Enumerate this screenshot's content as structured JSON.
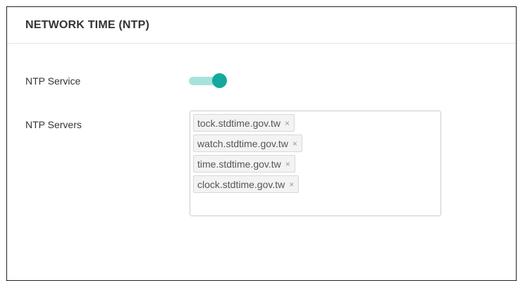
{
  "panel": {
    "title": "NETWORK TIME (NTP)"
  },
  "ntp_service": {
    "label": "NTP Service",
    "enabled": true,
    "toggle_color": "#13a99d",
    "toggle_track_color": "#a7e3dc"
  },
  "ntp_servers": {
    "label": "NTP Servers",
    "tags": [
      {
        "label": "tock.stdtime.gov.tw",
        "remove": "×"
      },
      {
        "label": "watch.stdtime.gov.tw",
        "remove": "×"
      },
      {
        "label": "time.stdtime.gov.tw",
        "remove": "×"
      },
      {
        "label": "clock.stdtime.gov.tw",
        "remove": "×"
      }
    ]
  }
}
